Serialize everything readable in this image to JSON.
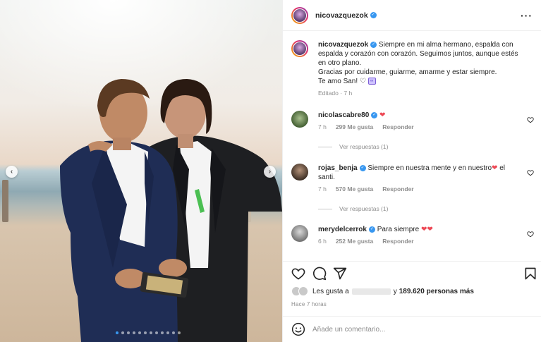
{
  "post": {
    "author": "nicovazquezok",
    "caption": {
      "line1": "Siempre en mi alma hermano, espalda con espalda y corazón con corazón. Seguimos juntos, aunque estés en otro plano.",
      "line2": "Gracias por cuidarme, guiarme, amarme y estar siempre.",
      "line3": "Te amo San!",
      "edited": "Editado · 7 h"
    },
    "comments": [
      {
        "user": "nicolascabre80",
        "text": "",
        "time": "7 h",
        "likes": "299 Me gusta",
        "reply": "Responder",
        "view_replies": "Ver respuestas (1)"
      },
      {
        "user": "rojas_benja",
        "text": "Siempre en nuestra mente y en nuestro",
        "text2": "el santi.",
        "time": "7 h",
        "likes": "570 Me gusta",
        "reply": "Responder",
        "view_replies": "Ver respuestas (1)"
      },
      {
        "user": "merydelcerrok",
        "text": "Para siempre",
        "time": "6 h",
        "likes": "252 Me gusta",
        "reply": "Responder"
      }
    ],
    "likes_prefix": "Les gusta a",
    "likes_suffix": "y",
    "likes_count": "189.620 personas más",
    "posted": "Hace 7 horas",
    "comment_placeholder": "Añade un comentario...",
    "carousel": {
      "total": 12,
      "active": 1
    }
  },
  "colors": {
    "verified": "#3897f0",
    "heart": "#ed4956",
    "muted": "#8e8e8e"
  },
  "icons": [
    "more-options-icon",
    "heart-icon",
    "comment-icon",
    "share-icon",
    "bookmark-icon",
    "emoji-icon",
    "chevron-left-icon",
    "chevron-right-icon"
  ]
}
